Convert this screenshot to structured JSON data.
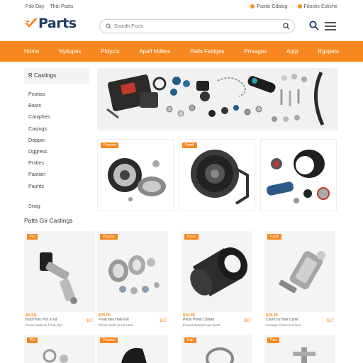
{
  "topbar": {
    "left_items": [
      "Fdo Day",
      "Thdi Pozts"
    ],
    "right_items": [
      "Pastic Cdalog",
      "Fdostic Estiche"
    ]
  },
  "header": {
    "logo_text": "Parts",
    "search": {
      "placeholder": "Scurdh Pczts"
    }
  },
  "nav": {
    "items": [
      "Home",
      "Ny/tupes",
      "Pfdycts",
      "Apalf Mdkes",
      "Patls Fstdges",
      "Prrsages",
      "Aqtp",
      "Rgopets"
    ]
  },
  "sidebar": {
    "title": "R Castings",
    "items": [
      "Pcotias",
      "Basts",
      "Caniphes",
      "Casings",
      "Dopper",
      "Dggress",
      "Prstles",
      "Pastian",
      "Pashts",
      "Sroig"
    ]
  },
  "categories": {
    "tags": [
      "Pasmra",
      "Famb"
    ]
  },
  "section": {
    "title": "Patts Gir Castings"
  },
  "products": [
    {
      "tag": "Plx",
      "price": "$X.ES",
      "name": "Inad Hosc Ptic a lud",
      "desc": "Pezas Yadeulo f Pao clpt",
      "price2": "$07"
    },
    {
      "tag": "Pasane",
      "price": "$25.00",
      "name": "Froat stes Hale Erit",
      "desc": "Ptlous Seirls pt Iat saes",
      "price2": "$17"
    },
    {
      "tag": "Pasis",
      "price": "$10.00",
      "name": "Pacts Pomit Clodad",
      "desc": "Ezuast Seivsjtrs up repad",
      "price2": "$87"
    },
    {
      "tag": "Pad4",
      "price": "$15.99",
      "name": "Caurit ns Hast Cspie",
      "desc": "Faxlopp Chacs trcd lace",
      "price2": "$17"
    }
  ],
  "products_row2": {
    "tags": [
      "Plx",
      "Pasone",
      "Pap",
      "Pau"
    ]
  },
  "colors": {
    "accent": "#f7881f",
    "logo": "#1f3c63"
  }
}
